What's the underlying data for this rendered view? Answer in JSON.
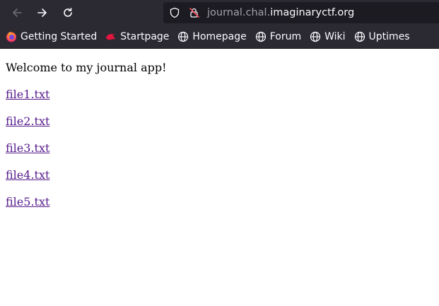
{
  "browser": {
    "url_prefix": "journal.chal.",
    "url_domain": "imaginaryctf.org",
    "bookmarks": [
      {
        "label": "Getting Started",
        "icon": "firefox-icon"
      },
      {
        "label": "Startpage",
        "icon": "startpage-icon"
      },
      {
        "label": "Homepage",
        "icon": "globe-icon"
      },
      {
        "label": "Forum",
        "icon": "globe-icon"
      },
      {
        "label": "Wiki",
        "icon": "globe-icon"
      },
      {
        "label": "Uptimes",
        "icon": "globe-icon"
      }
    ],
    "colors": {
      "toolbar_bg": "#2b2a33",
      "url_bg": "#1c1b22",
      "link_visited": "#551a8b"
    }
  },
  "page": {
    "heading": "Welcome to my journal app!",
    "files": [
      "file1.txt",
      "file2.txt",
      "file3.txt",
      "file4.txt",
      "file5.txt"
    ]
  }
}
